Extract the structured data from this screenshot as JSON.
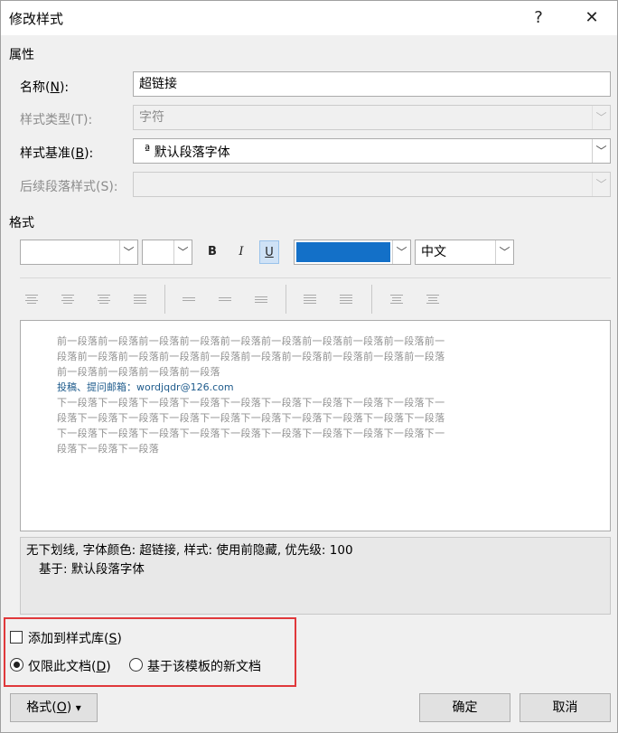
{
  "window": {
    "title": "修改样式",
    "help_glyph": "?",
    "close_glyph": "✕"
  },
  "properties": {
    "group_label": "属性",
    "name": {
      "label": "名称(",
      "key": "N",
      "label_end": "):",
      "value": "超链接"
    },
    "style_type": {
      "label": "样式类型(T):",
      "value": "字符"
    },
    "style_based_on": {
      "label": "样式基准(",
      "key": "B",
      "label_end": "):",
      "value": "默认段落字体",
      "icon": "ª"
    },
    "following_style": {
      "label": "后续段落样式(S):",
      "value": ""
    }
  },
  "format": {
    "group_label": "格式",
    "font_name": "",
    "font_size": "",
    "bold": "B",
    "italic": "I",
    "underline": "U",
    "color_hex": "#1370c8",
    "script": "中文"
  },
  "preview": {
    "prev_lines": [
      "前一段落前一段落前一段落前一段落前一段落前一段落前一段落前一段落前一段落前一",
      "段落前一段落前一段落前一段落前一段落前一段落前一段落前一段落前一段落前一段落",
      "前一段落前一段落前一段落前一段落"
    ],
    "sample_text": "投稿、提问邮箱：wordjqdr@126.com",
    "next_lines": [
      "下一段落下一段落下一段落下一段落下一段落下一段落下一段落下一段落下一段落下一",
      "段落下一段落下一段落下一段落下一段落下一段落下一段落下一段落下一段落下一段落",
      "下一段落下一段落下一段落下一段落下一段落下一段落下一段落下一段落下一段落下一",
      "段落下一段落下一段落"
    ]
  },
  "description": {
    "line1": "无下划线, 字体颜色: 超链接, 样式: 使用前隐藏, 优先级: 100",
    "line2": "基于: 默认段落字体"
  },
  "options": {
    "add_to_gallery": {
      "label": "添加到样式库(",
      "key": "S",
      "label_end": ")",
      "checked": false
    },
    "only_this_doc": {
      "label": "仅限此文档(",
      "key": "D",
      "label_end": ")",
      "selected": true
    },
    "new_docs_template": {
      "label": "基于该模板的新文档",
      "selected": false
    }
  },
  "buttons": {
    "format": {
      "label": "格式(",
      "key": "O",
      "label_end": ")",
      "arrow": "▾"
    },
    "ok": "确定",
    "cancel": "取消"
  }
}
